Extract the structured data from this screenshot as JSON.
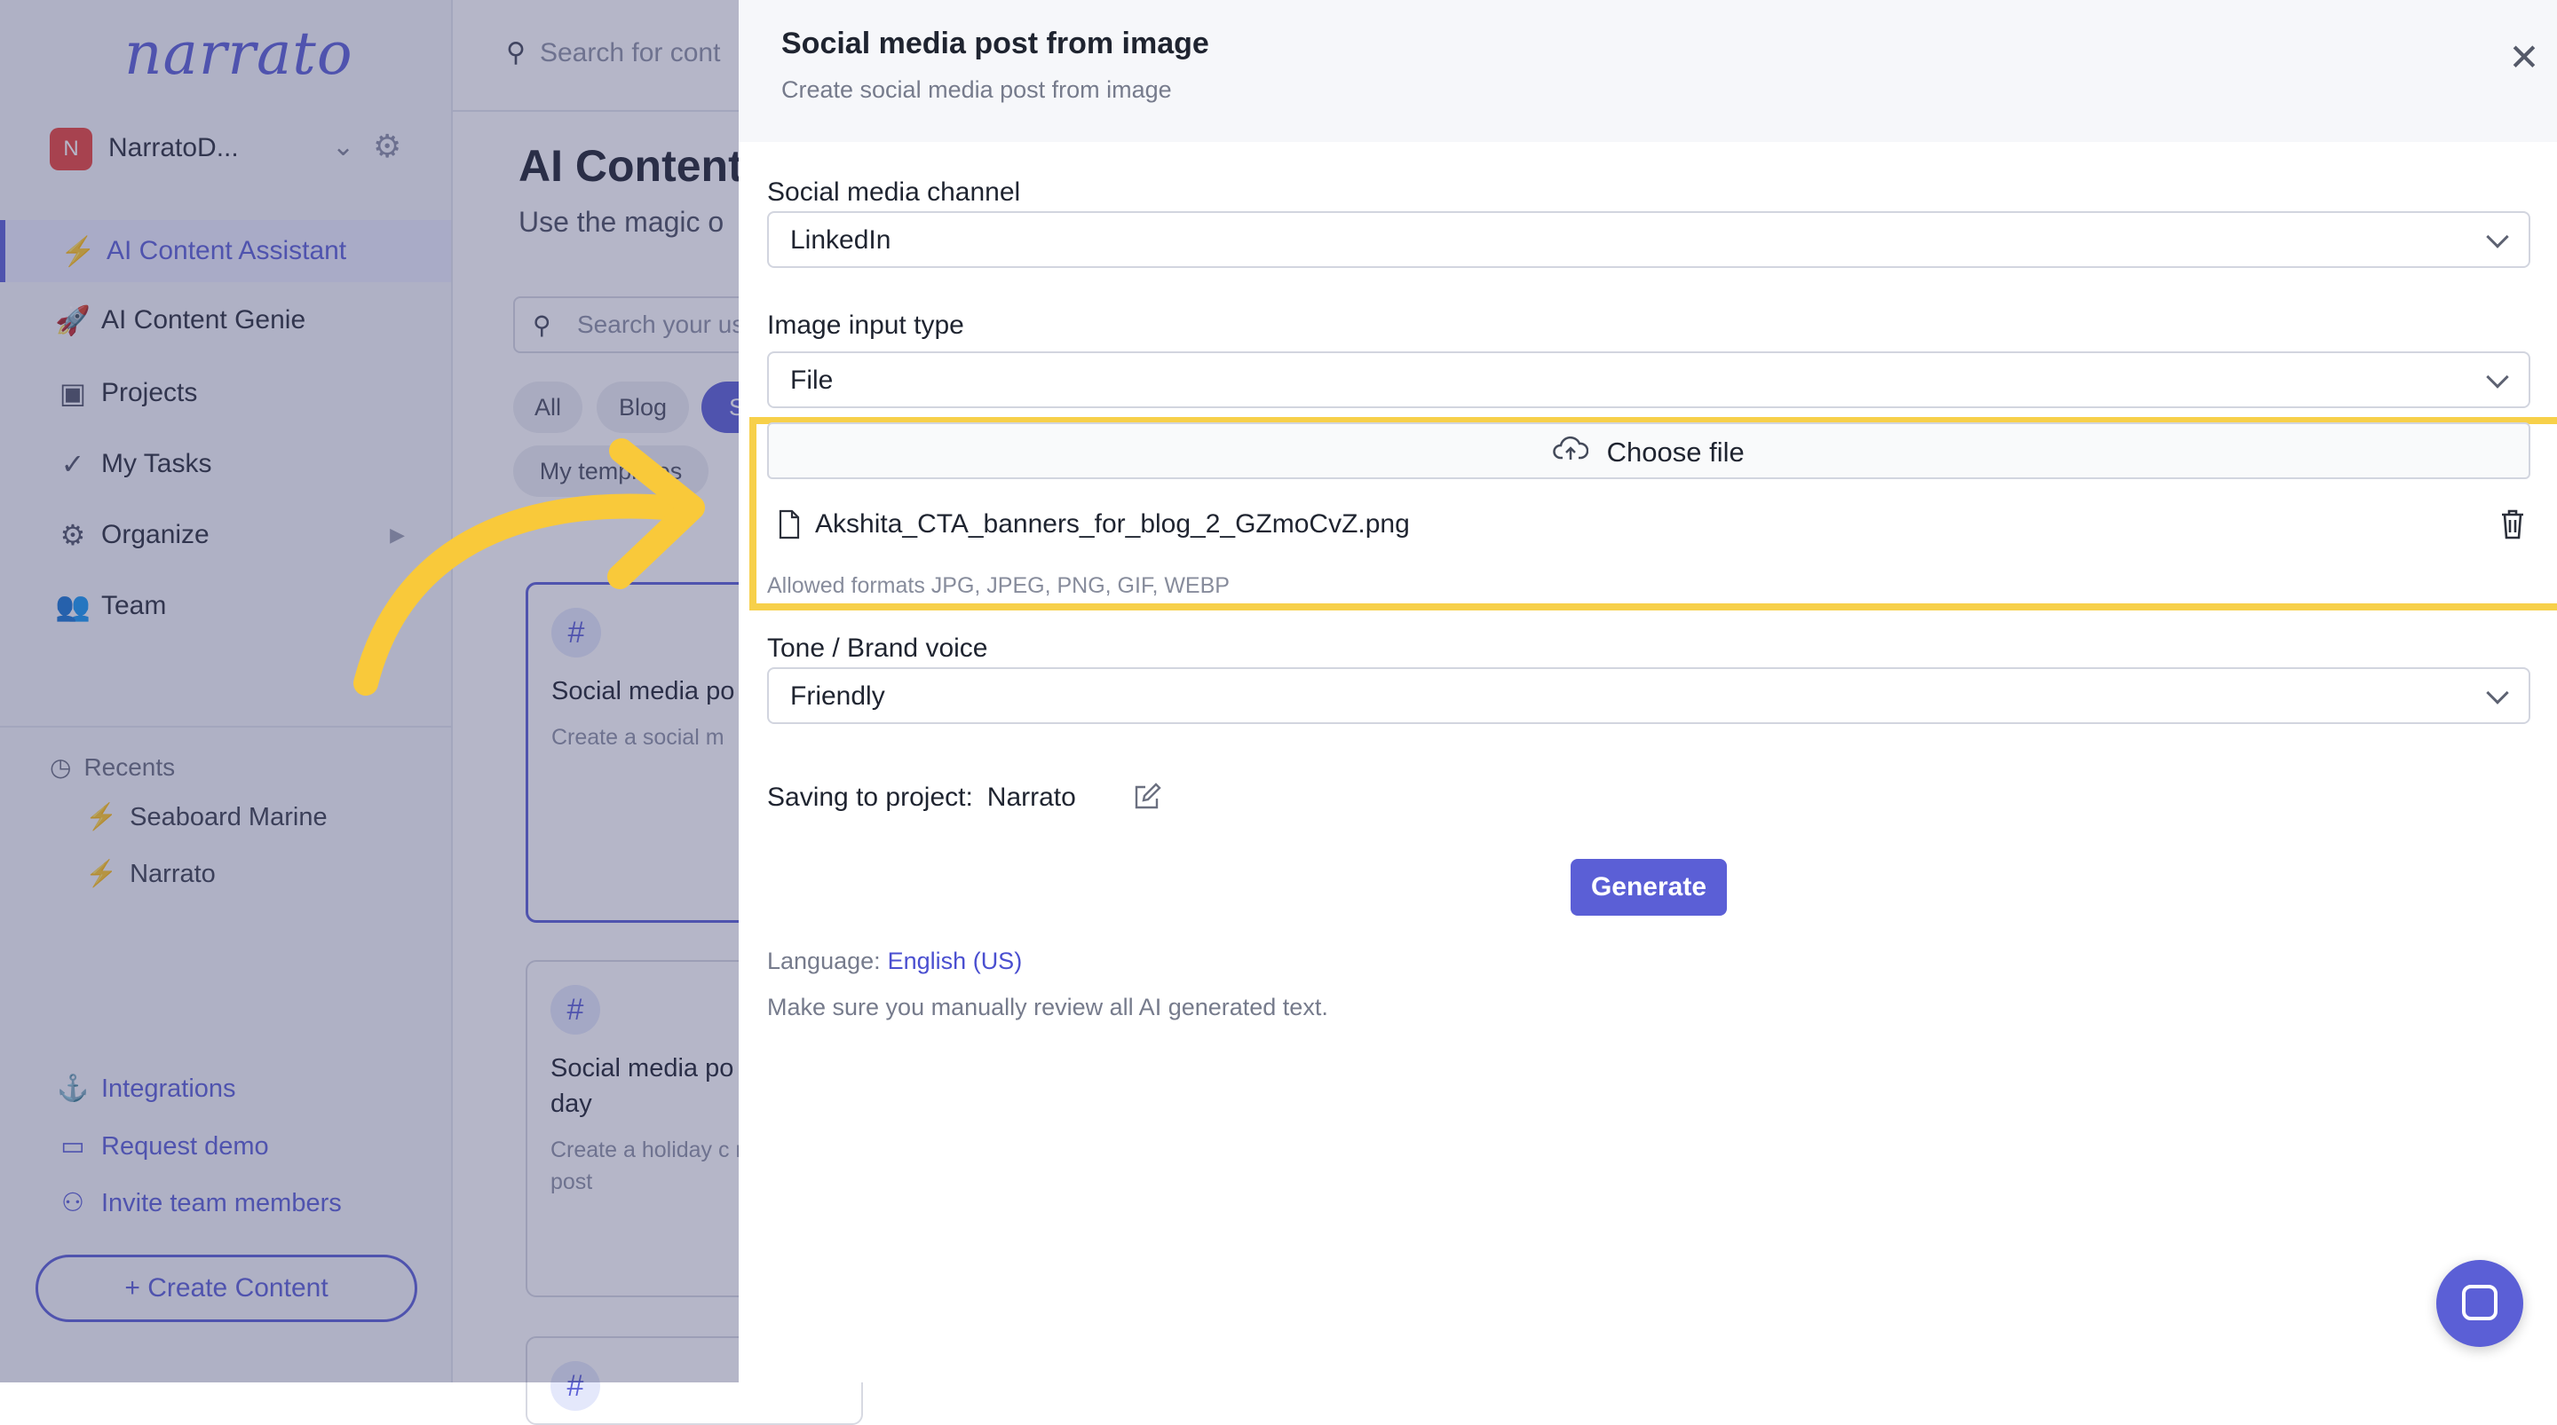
{
  "app": {
    "logo": "narrato",
    "workspace": {
      "initial": "N",
      "name": "NarratoD..."
    },
    "sidebar_items": [
      {
        "label": "AI Content Assistant",
        "icon": "lightning-icon",
        "active": true
      },
      {
        "label": "AI Content Genie",
        "icon": "rocket-icon"
      },
      {
        "label": "Projects",
        "icon": "briefcase-icon"
      },
      {
        "label": "My Tasks",
        "icon": "checkmark-icon"
      },
      {
        "label": "Organize",
        "icon": "gears-icon"
      },
      {
        "label": "Team",
        "icon": "team-icon"
      }
    ],
    "recents": {
      "heading": "Recents",
      "items": [
        "Seaboard Marine",
        "Narrato"
      ]
    },
    "bottom_links": [
      "Integrations",
      "Request demo",
      "Invite team members"
    ],
    "create_button": "+ Create Content",
    "top_search_placeholder": "Search for cont",
    "page_title": "AI Content",
    "page_subtitle": "Use the magic o",
    "usecase_search_placeholder": "Search your us",
    "chips": [
      "All",
      "Blog",
      "S",
      "My templates"
    ],
    "cards": [
      {
        "title": "Social media po",
        "desc": "Create a social m"
      },
      {
        "title": "Social media po special day",
        "desc": "Create a holiday c media post"
      }
    ]
  },
  "drawer": {
    "title": "Social media post from image",
    "subtitle": "Create social media post from image",
    "channel_label": "Social media channel",
    "channel_value": "LinkedIn",
    "input_type_label": "Image input type",
    "input_type_value": "File",
    "choose_file_label": "Choose file",
    "file_name": "Akshita_CTA_banners_for_blog_2_GZmoCvZ.png",
    "allowed_formats": "Allowed formats JPG, JPEG, PNG, GIF, WEBP",
    "tone_label": "Tone / Brand voice",
    "tone_value": "Friendly",
    "saving_label": "Saving to project:",
    "project_name": "Narrato",
    "generate_label": "Generate",
    "language_label": "Language:",
    "language_value": "English (US)",
    "review_note": "Make sure you manually review all AI generated text."
  },
  "colors": {
    "accent": "#5b5fd6",
    "highlight": "#f7d04a",
    "arrow": "#f9c93a"
  }
}
